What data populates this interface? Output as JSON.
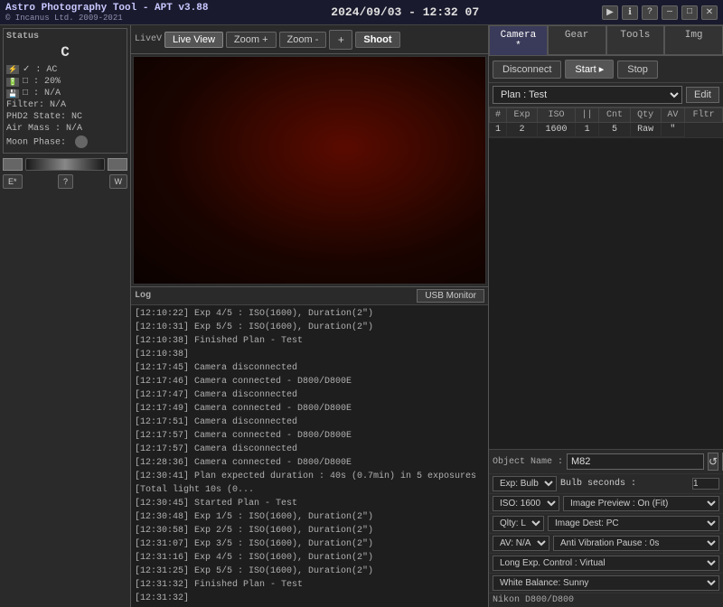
{
  "titlebar": {
    "app_name": "Astro Photography Tool  -  APT v3.88",
    "company": "© Incanus Ltd. 2009-2021",
    "datetime": "2024/09/03 - 12:32 07",
    "controls": [
      "▶",
      "ℹ",
      "?",
      "—",
      "□",
      "✕"
    ]
  },
  "status": {
    "title": "Status",
    "camera_indicator": "C",
    "ac_label": "✓ : AC",
    "battery_label": "□ : 20%",
    "storage_label": "□ : N/A",
    "filter_label": "Filter: N/A",
    "phd2_label": "PHD2 State: NC",
    "airmass_label": "Air Mass : N/A",
    "moonphase_label": "Moon Phase:"
  },
  "bottom_controls": {
    "e_star": "E*",
    "question": "?",
    "w": "W"
  },
  "liveview": {
    "live_label": "LiveV",
    "live_view_btn": "Live View",
    "zoom_in_btn": "Zoom +",
    "zoom_out_btn": "Zoom -",
    "crosshair_btn": "+",
    "shoot_btn": "Shoot"
  },
  "log": {
    "title": "Log",
    "usb_monitor_btn": "USB Monitor",
    "entries": [
      "[12:10:22] Exp 4/5 : ISO(1600), Duration(2\")",
      "[12:10:31] Exp 5/5 : ISO(1600), Duration(2\")",
      "[12:10:38] Finished Plan - Test",
      "[12:10:38]",
      "[12:17:45] Camera disconnected",
      "[12:17:46] Camera connected - D800/D800E",
      "[12:17:47] Camera disconnected",
      "[12:17:49] Camera connected - D800/D800E",
      "[12:17:51] Camera disconnected",
      "[12:17:57] Camera connected - D800/D800E",
      "[12:17:57] Camera disconnected",
      "[12:28:36] Camera connected - D800/D800E",
      "[12:30:41] Plan expected duration : 40s (0.7min) in 5 exposures [Total light 10s (0...",
      "[12:30:45] Started Plan - Test",
      "[12:30:48] Exp 1/5 : ISO(1600), Duration(2\")",
      "[12:30:58] Exp 2/5 : ISO(1600), Duration(2\")",
      "[12:31:07] Exp 3/5 : ISO(1600), Duration(2\")",
      "[12:31:16] Exp 4/5 : ISO(1600), Duration(2\")",
      "[12:31:25] Exp 5/5 : ISO(1600), Duration(2\")",
      "[12:31:32] Finished Plan - Test",
      "[12:31:32]"
    ]
  },
  "right_panel": {
    "tabs": [
      {
        "id": "camera",
        "label": "Camera *",
        "active": true
      },
      {
        "id": "gear",
        "label": "Gear",
        "active": false
      },
      {
        "id": "tools",
        "label": "Tools",
        "active": false
      },
      {
        "id": "img",
        "label": "Img",
        "active": false
      }
    ],
    "plan_controls": {
      "disconnect_btn": "Disconnect",
      "start_btn": "Start",
      "stop_btn": "Stop"
    },
    "plan_label": "Plan : Test",
    "edit_btn": "Edit",
    "table": {
      "headers": [
        "Exp",
        "ISO",
        "||",
        "Cnt",
        "Qty",
        "AV",
        "Fltr"
      ],
      "rows": [
        {
          "num": "1",
          "exp": "2",
          "iso": "1600",
          "pause": "1",
          "cnt": "1",
          "qty": "5",
          "av": "Raw",
          "fltr": "\"",
          "fltr2": "\""
        }
      ]
    },
    "object_name_label": "Object Name :",
    "object_name_value": "M82",
    "settings": [
      {
        "label": "Exp: Bulb",
        "right_label": "Bulb seconds :",
        "right_value": "1"
      },
      {
        "label": "ISO: 1600",
        "right_label": "Image Preview : On (Fit)",
        "right_value": ""
      },
      {
        "label": "Qlty: L",
        "right_label": "Image Dest: PC",
        "right_value": ""
      },
      {
        "label": "AV: N/A",
        "right_label": "Anti Vibration Pause : 0s",
        "right_value": ""
      },
      {
        "label": "Long Exp. Control : Virtual",
        "right_label": "",
        "right_value": ""
      },
      {
        "label": "White Balance: Sunny",
        "right_label": "",
        "right_value": ""
      }
    ],
    "camera_label": "Nikon D800/D800"
  }
}
